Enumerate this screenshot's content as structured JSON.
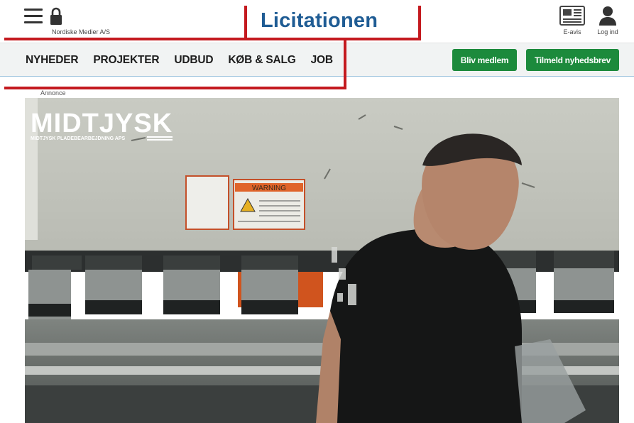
{
  "header": {
    "publisher": "Nordiske Medier A/S",
    "logo_text": "Licitationen",
    "eavis_label": "E-avis",
    "login_label": "Log ind"
  },
  "nav": {
    "items": [
      {
        "label": "NYHEDER"
      },
      {
        "label": "PROJEKTER"
      },
      {
        "label": "UDBUD"
      },
      {
        "label": "KØB & SALG"
      },
      {
        "label": "JOB"
      }
    ],
    "member_button": "Bliv medlem",
    "newsletter_button": "Tilmeld nyhedsbrev"
  },
  "ad": {
    "label": "Annonce",
    "brand": "MIDTJYSK",
    "brand_sub": "MIDTJYSK PLADEBEARBEJDNING APS",
    "warning_text": "WARNING"
  },
  "colors": {
    "brand_blue": "#1f5c94",
    "button_green": "#1c8a3c",
    "annotation_red": "#c41a1f"
  }
}
